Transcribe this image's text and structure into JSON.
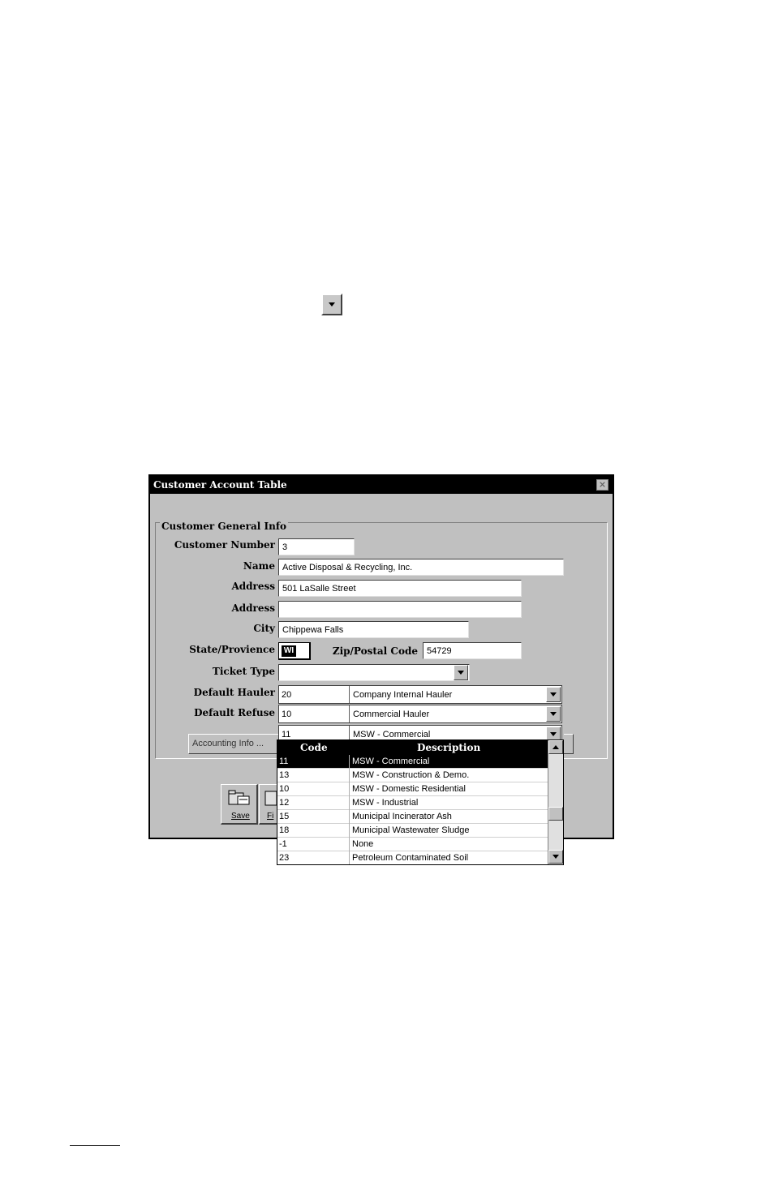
{
  "dialog": {
    "title": "Customer Account Table",
    "close_label": "×",
    "group_title": "Customer General Info",
    "labels": {
      "customer_number": "Customer Number",
      "name": "Name",
      "address1": "Address",
      "address2": "Address",
      "city": "City",
      "state": "State/Provience",
      "zip": "Zip/Postal Code",
      "ticket_type": "Ticket Type",
      "default_hauler": "Default Hauler",
      "default_refuse": "Default Refuse"
    },
    "values": {
      "customer_number": "3",
      "name": "Active Disposal & Recycling, Inc.",
      "address1": "501 LaSalle Street",
      "address2": "",
      "city": "Chippewa Falls",
      "state": "WI",
      "zip": "54729",
      "ticket_type": ""
    },
    "hauler": {
      "code": "20",
      "description": "Company Internal Hauler"
    },
    "refuse": {
      "code": "10",
      "description": "Commercial Hauler"
    },
    "open_combo": {
      "code": "11",
      "description": "MSW - Commercial"
    },
    "accounting_button": "Accounting Info ...",
    "toolbar": {
      "save_label": "Save",
      "second_label": "Fi"
    }
  },
  "dropdown": {
    "headers": {
      "code": "Code",
      "description": "Description"
    },
    "rows": [
      {
        "code": "11",
        "description": "MSW - Commercial"
      },
      {
        "code": "13",
        "description": "MSW - Construction & Demo."
      },
      {
        "code": "10",
        "description": "MSW - Domestic Residential"
      },
      {
        "code": "12",
        "description": "MSW - Industrial"
      },
      {
        "code": "15",
        "description": "Municipal Incinerator Ash"
      },
      {
        "code": "18",
        "description": "Municipal Wastewater Sludge"
      },
      {
        "code": "-1",
        "description": "None"
      },
      {
        "code": "23",
        "description": "Petroleum Contaminated Soil"
      }
    ],
    "selected_index": 0
  }
}
